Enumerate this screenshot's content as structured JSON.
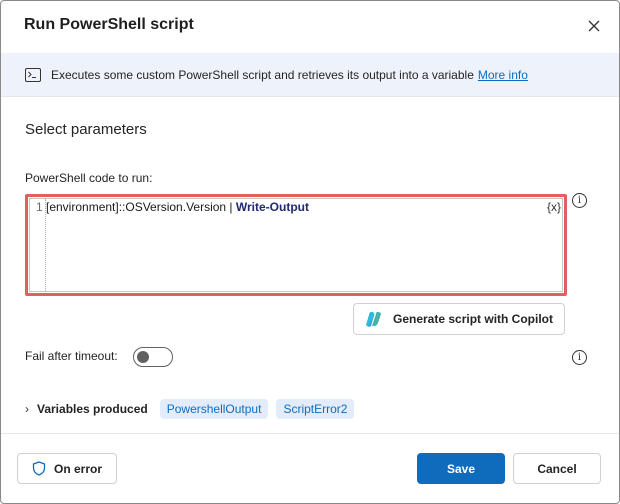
{
  "dialog": {
    "title": "Run PowerShell script",
    "close_icon": "close-icon"
  },
  "info_bar": {
    "icon": "terminal-icon",
    "text": "Executes some custom PowerShell script and retrieves its output into a variable",
    "link": "More info"
  },
  "section": {
    "title": "Select parameters"
  },
  "code_field": {
    "label": "PowerShell code to run:",
    "line_number": "1",
    "code_prefix": "[environment]::OSVersion.Version | ",
    "code_keyword": "Write-Output",
    "variable_button": "{x}",
    "info_icon": "info-icon",
    "highlight_color": "#e06060"
  },
  "copilot": {
    "label": "Generate script with Copilot",
    "icon": "copilot-icon"
  },
  "timeout": {
    "label": "Fail after timeout:",
    "toggle_on": false,
    "info_icon": "info-icon"
  },
  "variables": {
    "chevron": "›",
    "label": "Variables produced",
    "items": [
      "PowershellOutput",
      "ScriptError2"
    ]
  },
  "footer": {
    "on_error": "On error",
    "on_error_icon": "shield-icon",
    "save": "Save",
    "cancel": "Cancel"
  },
  "colors": {
    "accent": "#0f6cbd",
    "info_bar_bg": "#eef2fb",
    "chip_bg": "#e3ecfa"
  }
}
